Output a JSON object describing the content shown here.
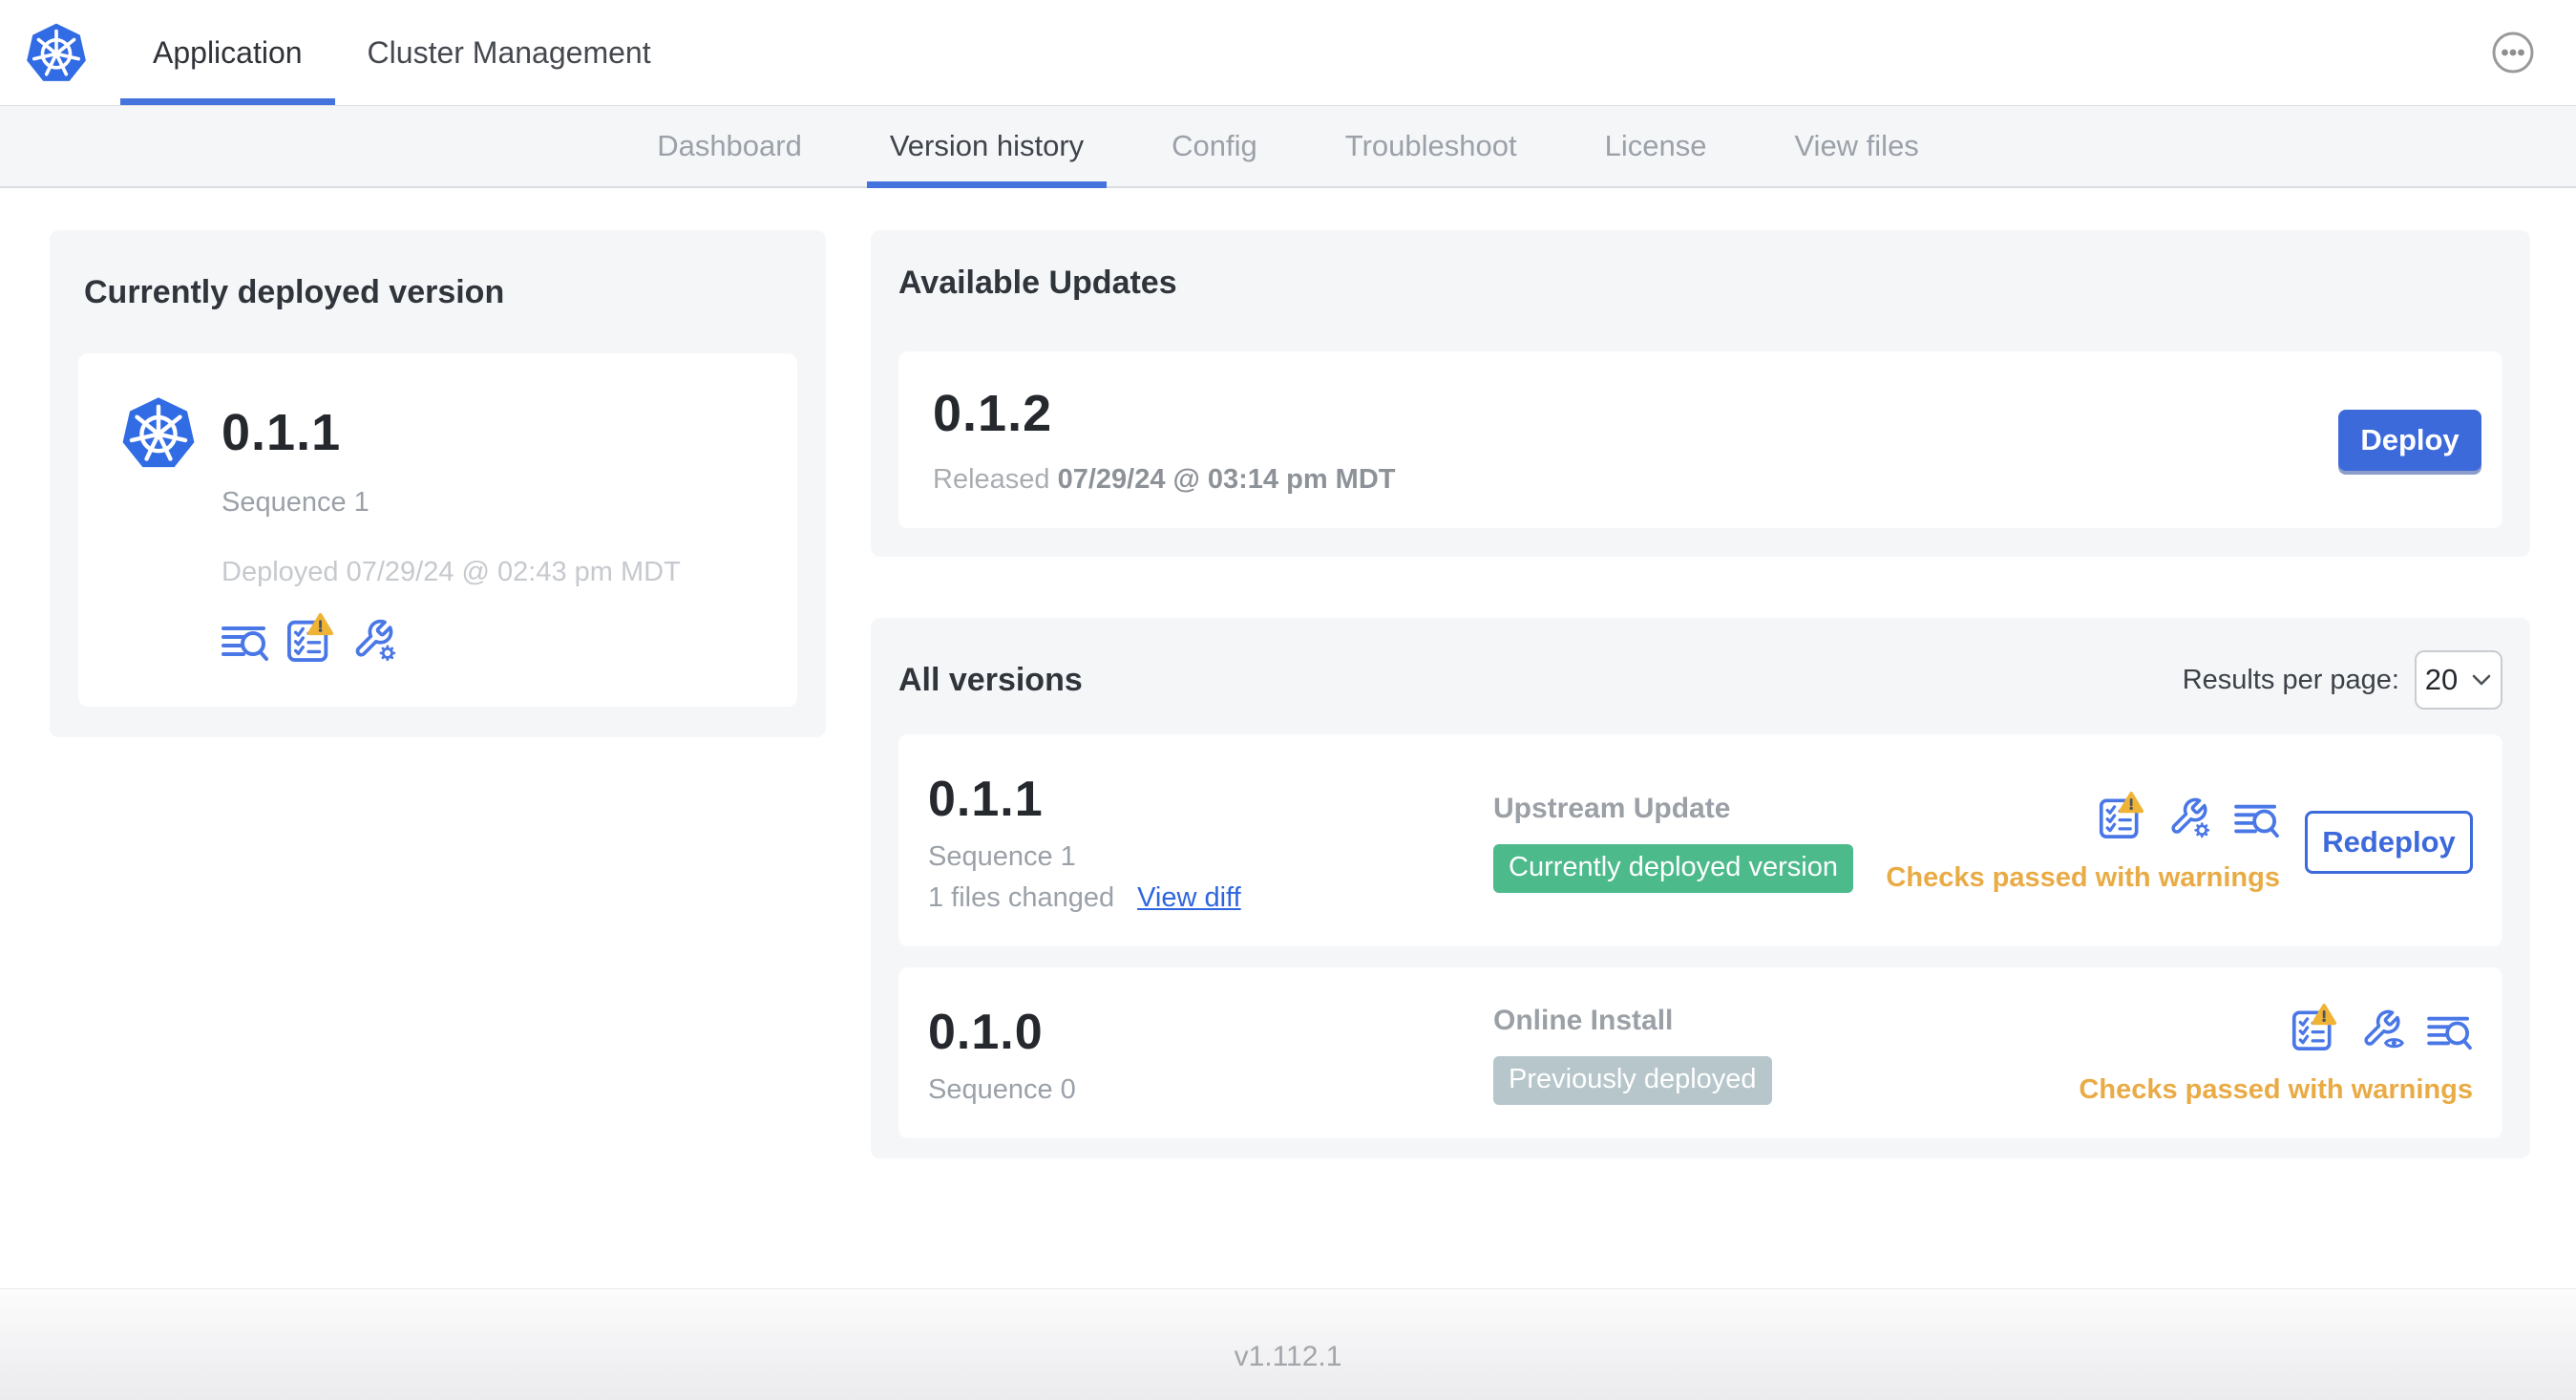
{
  "header": {
    "tabs": [
      "Application",
      "Cluster Management"
    ],
    "active_tab": "Application",
    "menu_icon": "ellipsis-menu-icon"
  },
  "subnav": {
    "items": [
      "Dashboard",
      "Version history",
      "Config",
      "Troubleshoot",
      "License",
      "View files"
    ],
    "active": "Version history"
  },
  "current_version_card": {
    "title": "Currently deployed version",
    "version": "0.1.1",
    "sequence": "Sequence 1",
    "deployed": "Deployed 07/29/24 @ 02:43 pm MDT",
    "icons": [
      "diff-icon",
      "preflight-checks-warning-icon",
      "edit-config-icon"
    ]
  },
  "available_updates": {
    "title": "Available Updates",
    "version": "0.1.2",
    "released_prefix": "Released ",
    "released_date": "07/29/24 @ 03:14 pm MDT",
    "deploy_label": "Deploy"
  },
  "all_versions": {
    "title": "All versions",
    "results_per_page_label": "Results per page:",
    "results_per_page_value": "20",
    "rows": [
      {
        "version": "0.1.1",
        "sequence": "Sequence 1",
        "files_changed": "1 files changed",
        "view_diff_label": "View diff",
        "source": "Upstream Update",
        "badge": "Currently deployed version",
        "badge_color": "#4cba8b",
        "icons": [
          "preflight-checks-warning-icon",
          "edit-config-icon",
          "diff-icon"
        ],
        "action_label": "Redeploy",
        "status": "Checks passed with warnings"
      },
      {
        "version": "0.1.0",
        "sequence": "Sequence 0",
        "source": "Online Install",
        "badge": "Previously deployed",
        "badge_color": "#b6c6cb",
        "icons": [
          "preflight-checks-warning-icon",
          "view-config-icon",
          "diff-icon"
        ],
        "status": "Checks passed with warnings"
      }
    ]
  },
  "footer": {
    "version": "v1.112.1"
  },
  "colors": {
    "accent_blue": "#3d6adb",
    "icon_blue": "#4a77e6",
    "link_blue": "#2f66dd",
    "tab_underline_blue": "#4573de",
    "k8s_logo_blue": "#326ce5",
    "green_badge": "#4cba8b",
    "gray_badge": "#b6c6cb",
    "warning_amber": "#e9ab45",
    "card_gray": "#f4f6f8"
  }
}
